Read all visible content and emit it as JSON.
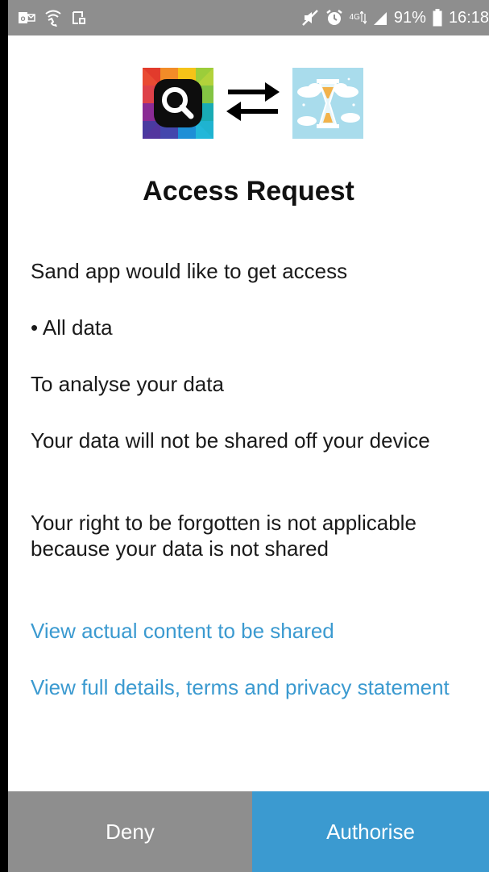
{
  "status_bar": {
    "icons": [
      "outlook-icon",
      "wifi-calling-icon",
      "screenshot-icon"
    ],
    "right_icons": [
      "mute-icon",
      "alarm-icon",
      "network-4g-icon",
      "signal-icon"
    ],
    "network_label": "4G",
    "battery_percent": "91%",
    "time": "16:18"
  },
  "colors": {
    "status_bar_bg": "#8e8e8e",
    "deny_bg": "#8e8e8e",
    "authorise_bg": "#3b9ad0",
    "link": "#3b9ad0"
  },
  "hero": {
    "left_icon": "search-app-icon",
    "middle_icon": "swap-arrows-icon",
    "right_icon": "hourglass-app-icon"
  },
  "request": {
    "title": "Access Request",
    "intro": "Sand app would like to get access",
    "scope": "• All data",
    "purpose": "To analyse your data",
    "sharing_note": "Your data will not be shared off your device",
    "forgotten_note": "Your right to be forgotten is not applicable because your data is not shared",
    "link_content": "View actual content to be shared",
    "link_terms": "View full details, terms and privacy statement"
  },
  "actions": {
    "deny_label": "Deny",
    "authorise_label": "Authorise"
  }
}
